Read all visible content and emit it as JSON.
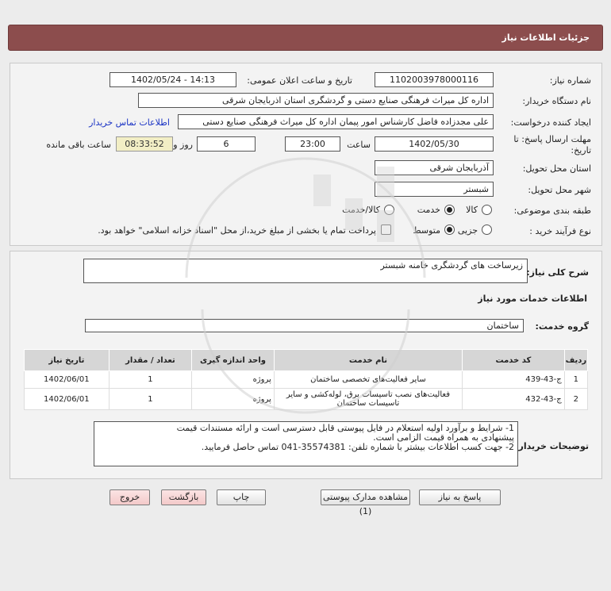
{
  "header": {
    "title": "جزئیات اطلاعات نیاز"
  },
  "fields": {
    "need_number_label": "شماره نیاز:",
    "need_number": "1102003978000116",
    "announce_label": "تاریخ و ساعت اعلان عمومی:",
    "announce_value": "1402/05/24 - 14:13",
    "buyer_org_label": "نام دستگاه خریدار:",
    "buyer_org": "اداره کل میراث فرهنگی  صنایع دستی و گردشگری استان اذربایجان شرقی",
    "creator_label": "ایجاد کننده درخواست:",
    "creator": "علی مجدزاده فاضل کارشناس امور پیمان اداره کل میراث فرهنگی  صنایع دستی",
    "contact_link": "اطلاعات تماس خریدار",
    "deadline_label_1": "مهلت ارسال پاسخ: تا",
    "deadline_label_2": "تاریخ:",
    "deadline_date": "1402/05/30",
    "time_label": "ساعت",
    "deadline_time": "23:00",
    "days_value": "6",
    "days_label": "روز و",
    "remaining_time": "08:33:52",
    "remaining_label": "ساعت باقی مانده",
    "province_label": "استان محل تحویل:",
    "province": "آذربایجان شرقی",
    "city_label": "شهر محل تحویل:",
    "city": "شبستر",
    "category_label": "طبقه بندی موضوعی:",
    "category_options": [
      "کالا",
      "خدمت",
      "کالا/خدمت"
    ],
    "process_label": "نوع فرآیند خرید :",
    "process_options": [
      "جزیی",
      "متوسط"
    ],
    "payment_note": "پرداخت تمام یا بخشی از مبلغ خرید،از محل \"اسناد خزانه اسلامی\" خواهد بود."
  },
  "summary": {
    "label": "شرح کلی نیاز:",
    "value": "زیرساخت های گردشگری خامنه شبستر",
    "services_title": "اطلاعات خدمات مورد نیاز",
    "group_label": "گروه خدمت:",
    "group_value": "ساختمان"
  },
  "table": {
    "headers": [
      "ردیف",
      "کد خدمت",
      "نام خدمت",
      "واحد اندازه گیری",
      "تعداد / مقدار",
      "تاریخ نیاز"
    ],
    "rows": [
      [
        "1",
        "ج-43-439",
        "سایر فعالیت‌های تخصصی ساختمان",
        "پروژه",
        "1",
        "1402/06/01"
      ],
      [
        "2",
        "ج-43-432",
        "فعالیت‌های نصب تاسیسات برق، لوله‌کشی و سایر تاسیسات ساختمان",
        "پروژه",
        "1",
        "1402/06/01"
      ]
    ]
  },
  "buyer_notes": {
    "label": "توضیحات خریدار:",
    "lines": [
      "1- شرایط و برآورد اولیه استعلام در فایل پیوستی قابل دسترسی است و ارائه مستندات قیمت",
      "پیشنهادی به همراه قیمت الزامی است.",
      "2- جهت کسب اطلاعات بیشتر  با شماره تلفن: 35574381-041  تماس حاصل فرمایید."
    ]
  },
  "buttons": {
    "reply": "پاسخ به نیاز",
    "attachments": "مشاهده مدارک پیوستی (1)",
    "print": "چاپ",
    "back": "بازگشت",
    "exit": "خروج"
  }
}
